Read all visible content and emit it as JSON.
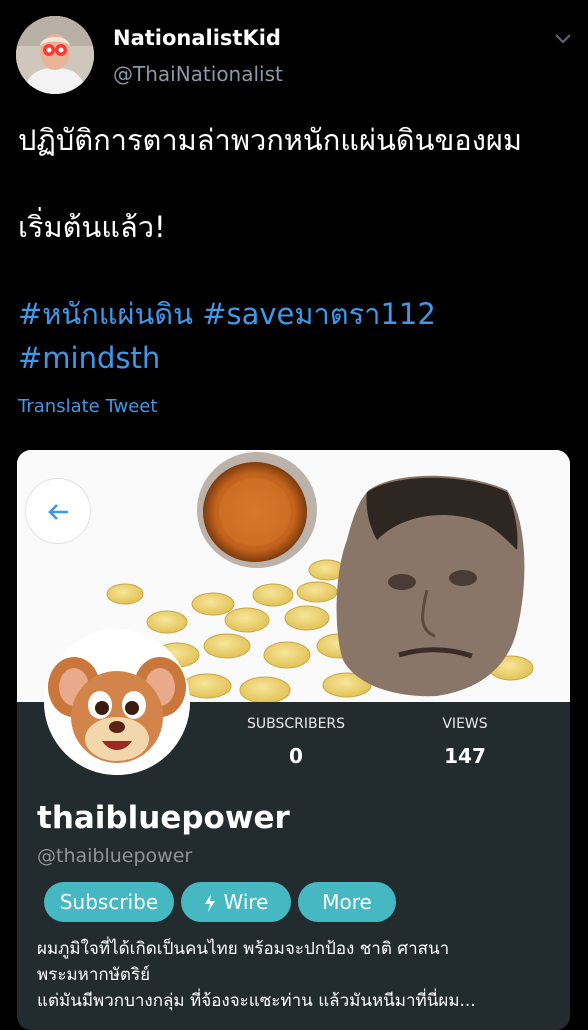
{
  "tweet": {
    "display_name": "NationalistKid",
    "handle": "@ThaiNationalist",
    "text_line1": "ปฏิบัติการตามล่าพวกหนักแผ่นดินของผม",
    "text_line2": "เริ่มต้นแล้ว!",
    "hashtag_1": "#หนักแผ่นดิน",
    "hashtag_2": "#saveมาตรา112",
    "hashtag_3": "#mindsth",
    "translate_label": "Translate Tweet"
  },
  "card": {
    "subscribers_label": "SUBSCRIBERS",
    "subscribers_value": "0",
    "views_label": "VIEWS",
    "views_value": "147",
    "channel_name": "thaibluepower",
    "channel_handle": "@thaibluepower",
    "subscribe_label": "Subscribe",
    "wire_label": "Wire",
    "more_label": "More",
    "description_line1": "ผมภูมิใจที่ได้เกิดเป็นคนไทย พร้อมจะปกป้อง ชาติ ศาสนา",
    "description_line2": "พระมหากษัตริย์",
    "description_line3": "แต่มันมีพวกบางกลุ่ม ที่จ้องจะแซะท่าน แล้วมันหนีมาที่นี่ผม..."
  },
  "colors": {
    "background": "#000000",
    "link_blue": "#3f98e8",
    "card_bg": "#222b2e",
    "button_teal": "#46b8c1",
    "avatar_eye_red": "#ff2a2a"
  }
}
